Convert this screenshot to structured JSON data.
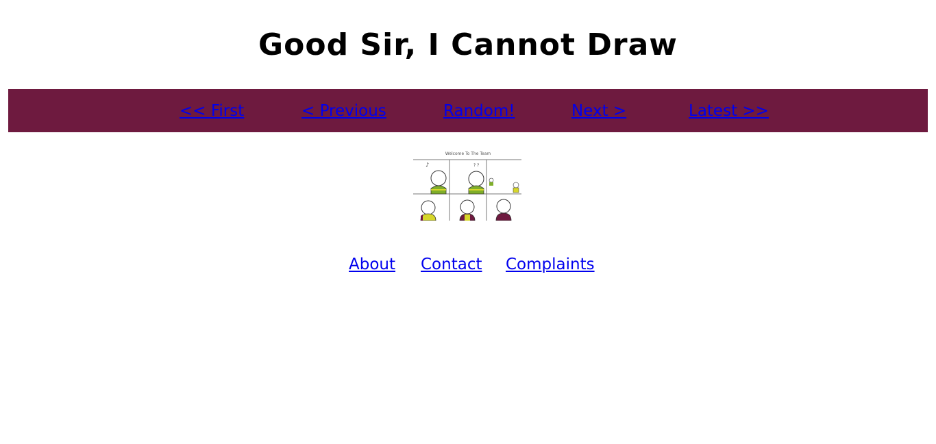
{
  "site": {
    "title": "Good Sir, I Cannot Draw"
  },
  "nav": {
    "first": "<< First",
    "previous": "< Previous",
    "random": "Random!",
    "next": "Next >",
    "latest": "Latest >>"
  },
  "comic": {
    "caption": "Welcome To The Team"
  },
  "footer": {
    "about": "About",
    "contact": "Contact",
    "complaints": "Complaints"
  },
  "colors": {
    "nav_background": "#6e1a3f",
    "link": "#0000ee",
    "title": "#000000",
    "shirt_green": "#7fae2a",
    "shirt_yellow": "#d6d62a",
    "shirt_maroon": "#6e1a3f"
  }
}
